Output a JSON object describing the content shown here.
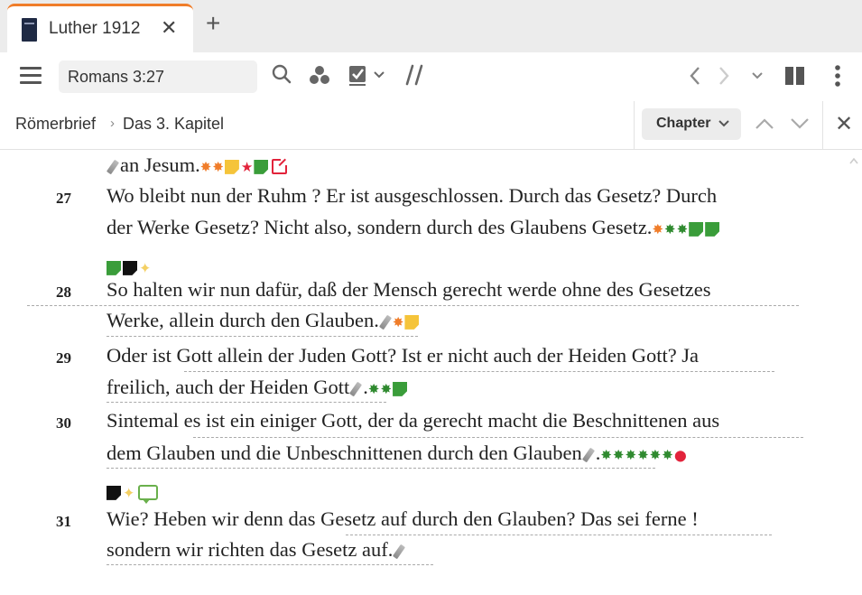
{
  "tab": {
    "title": "Luther 1912",
    "close_glyph": "✕",
    "add_glyph": "+",
    "book_icon": "book-cover-icon"
  },
  "toolbar": {
    "search_value": "Romans 3:27",
    "icons": [
      "menu-icon",
      "search-icon",
      "visual-filters-icon",
      "checkbox-icon",
      "chevron-down-icon",
      "parallel-icon",
      "back-icon",
      "forward-icon",
      "history-dropdown-icon",
      "split-panel-icon",
      "more-icon"
    ]
  },
  "breadcrumb": {
    "book": "Römerbrief",
    "separator": "›",
    "chapter": "Das 3. Kapitel",
    "chapter_button": "Chapter",
    "close_glyph": "✕"
  },
  "colors": {
    "accent": "#f07d2a",
    "green_star": "#2f8a2f",
    "red": "#e2233b",
    "yellow": "#f5c43a"
  },
  "verses": [
    {
      "num": "",
      "lines": [
        "an Jesum."
      ]
    },
    {
      "num": "27",
      "lines": [
        "Wo bleibt nun der Ruhm ? Er ist ausgeschlossen. Durch das Gesetz? Durch",
        "der Werke Gesetz? Nicht also, sondern durch des Glaubens Gesetz."
      ]
    },
    {
      "num": "28",
      "lines": [
        "So halten wir nun dafür, daß der Mensch gerecht werde ohne des Gesetzes",
        "Werke, allein durch den Glauben."
      ]
    },
    {
      "num": "29",
      "lines": [
        "Oder ist Gott allein der Juden Gott? Ist er nicht auch der Heiden Gott? Ja",
        "freilich, auch der Heiden Gott",
        "."
      ]
    },
    {
      "num": "30",
      "lines": [
        "Sintemal es ist ein einiger Gott, der da gerecht macht die Beschnittenen aus",
        "dem Glauben und die Unbeschnittenen durch den Glauben",
        "."
      ]
    },
    {
      "num": "31",
      "lines": [
        "Wie? Heben wir denn das Gesetz auf durch den Glauben? Das sei ferne !",
        "sondern wir richten das Gesetz auf."
      ]
    }
  ]
}
